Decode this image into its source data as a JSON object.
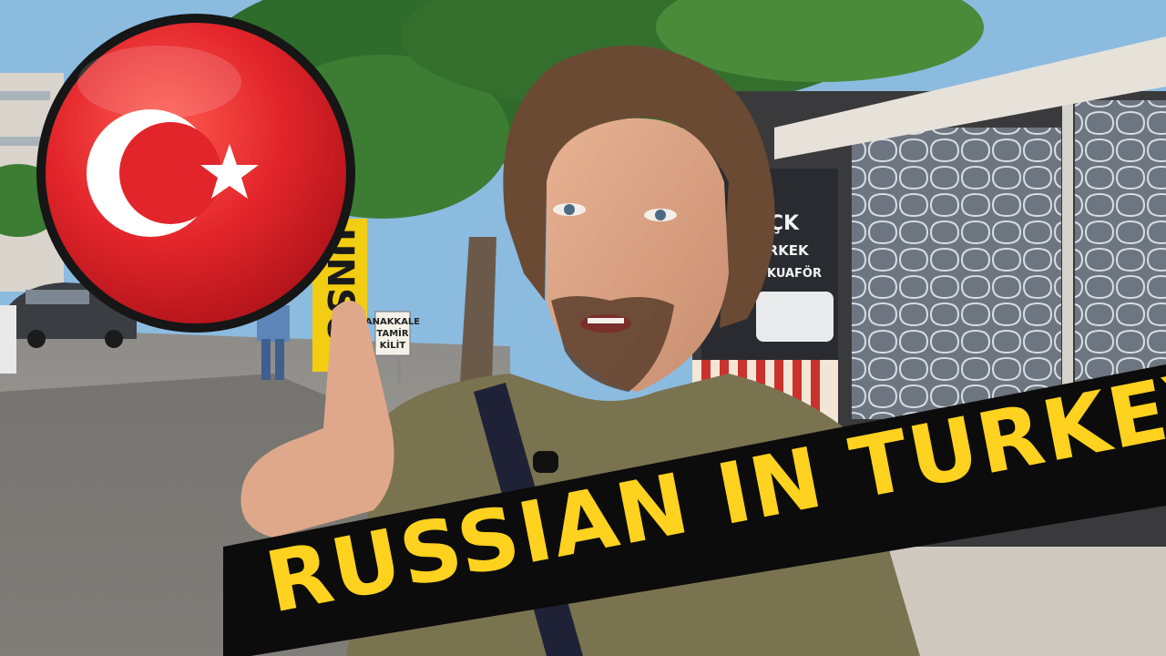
{
  "thumbnail": {
    "title_banner": "RUSSIAN IN TURKEY",
    "shop_sign_lines": [
      "SEÇK",
      "ERKEK",
      "KUAFÖR"
    ],
    "yellow_sign_letters": "UNSU",
    "street_sign_lines": [
      "ANAKKALE",
      "TAMİR",
      "KİLİT"
    ],
    "flag_badge": {
      "country": "Turkey",
      "symbol": "crescent-and-star"
    },
    "colors": {
      "flag_red": "#e2252b",
      "banner_black": "#0c0c0c",
      "banner_text_yellow": "#ffd21f",
      "shirt_olive": "#7a7350",
      "sky": "#7fb0d8",
      "foliage": "#2f6b2a"
    }
  }
}
